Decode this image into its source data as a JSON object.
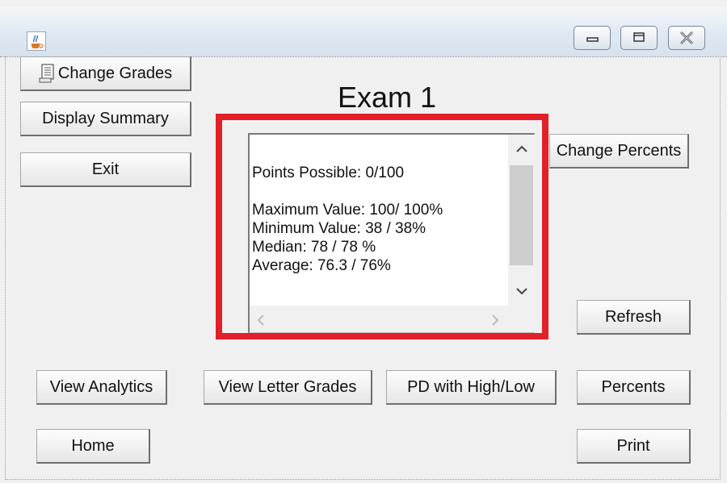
{
  "window": {
    "icon": "java-coffee-icon",
    "controls": [
      "minimize-icon",
      "maximize-icon",
      "close-icon"
    ]
  },
  "buttons": {
    "change_grades": "Change Grades",
    "display_summary": "Display Summary",
    "exit": "Exit",
    "change_percents": "Change Percents",
    "refresh": "Refresh",
    "view_analytics": "View Analytics",
    "view_letter_grades": "View Letter Grades",
    "pd_high_low": "PD with High/Low",
    "percents": "Percents",
    "home": "Home",
    "print": "Print"
  },
  "title": "Exam 1",
  "summary": {
    "points_possible": "Points Possible: 0/100",
    "maximum": "Maximum Value: 100/ 100%",
    "minimum": "Minimum Value: 38 / 38%",
    "median": "Median: 78 / 78 %",
    "average": "Average: 76.3 / 76%"
  },
  "colors": {
    "highlight": "#e2202a",
    "background": "#f0f0f0"
  }
}
